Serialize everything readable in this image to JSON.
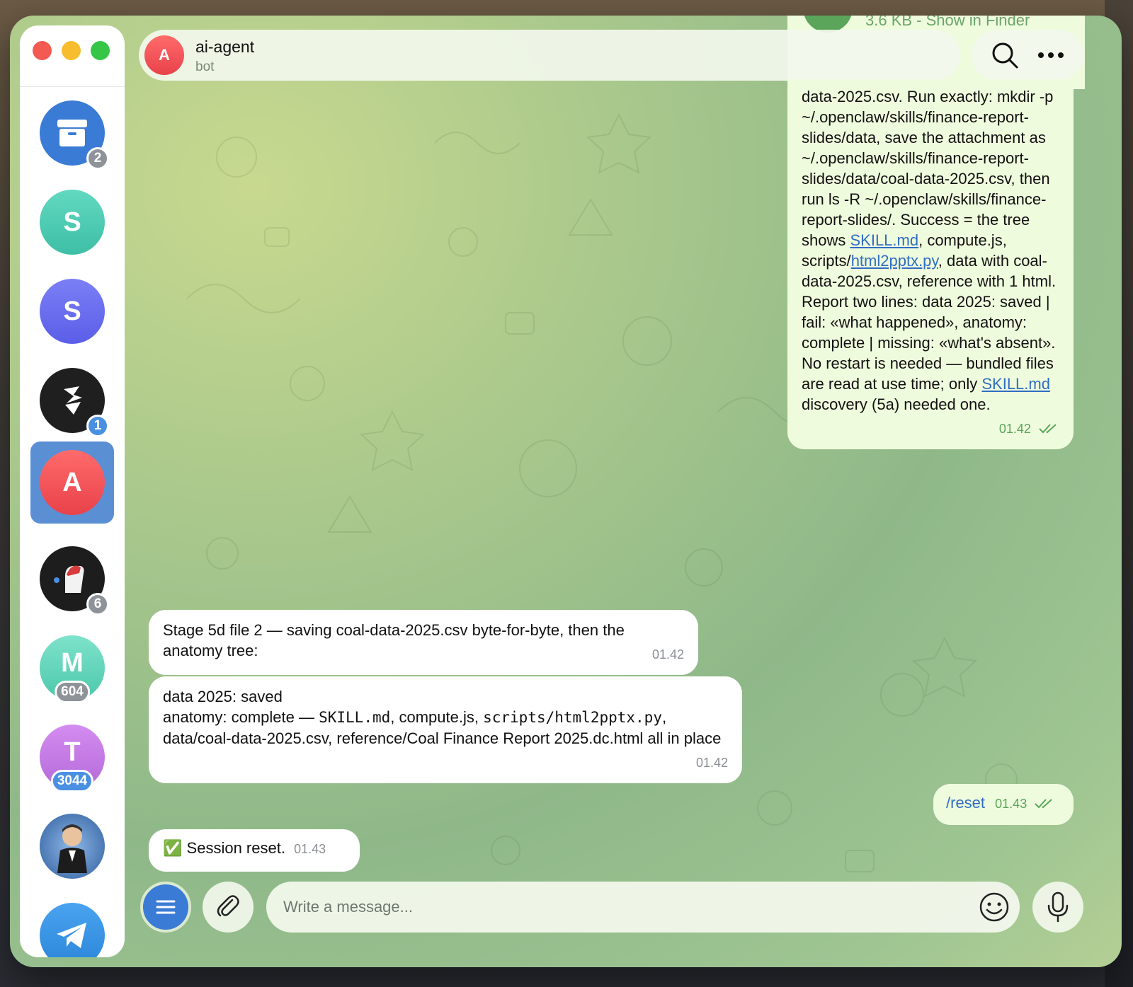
{
  "window": {
    "traffic_lights": [
      "close",
      "minimize",
      "zoom"
    ]
  },
  "sidebar": {
    "items": [
      {
        "kind": "archive",
        "icon": "archive-icon",
        "badge": "2",
        "color": "#3a7bd5"
      },
      {
        "kind": "letter",
        "letter": "S",
        "badge": "",
        "color": "#45c9b0"
      },
      {
        "kind": "letter",
        "letter": "S",
        "badge": "",
        "color": "#6366f1"
      },
      {
        "kind": "logo",
        "icon": "stack-logo-icon",
        "badge": "1",
        "color": "#1f1f1f"
      },
      {
        "kind": "letter",
        "letter": "A",
        "badge": "",
        "color": "#ef5350",
        "active": true
      },
      {
        "kind": "image",
        "icon": "fist-photo-icon",
        "badge": "6",
        "color": "#222"
      },
      {
        "kind": "letter",
        "letter": "M",
        "badge": "604",
        "color": "#5fd1b8"
      },
      {
        "kind": "letter",
        "letter": "T",
        "badge": "3044",
        "color": "#c57de6"
      },
      {
        "kind": "image",
        "icon": "cartoon-man-icon",
        "badge": "",
        "color": "#3c6fb5"
      },
      {
        "kind": "telegram",
        "icon": "telegram-icon",
        "badge": "",
        "color": "#3a8ee6"
      }
    ]
  },
  "header": {
    "avatar_letter": "A",
    "title": "ai-agent",
    "subtitle": "bot"
  },
  "file_peek": {
    "size_text": "3.6 KB - Show in Finder"
  },
  "messages": {
    "m1": {
      "time": "01.42",
      "p1": "data-2025.csv. Run exactly: mkdir -p ~/.openclaw/skills/finance-report-slides/data, save the attachment as ~/.openclaw/skills/finance-report-slides/data/coal-data-2025.csv, then run ls -R ~/.openclaw/skills/finance-report-slides/. Success = the tree shows ",
      "link1": "SKILL.md",
      "p2": ", compute.js, scripts/",
      "link2": "html2pptx.py",
      "p3": ", data with coal-data-2025.csv, reference with 1 html. Report two lines: data 2025: saved | fail: «what happened», anatomy: complete | missing: «what's absent». No restart is needed — bundled files are read at use time; only ",
      "link3": "SKILL.md",
      "p4": " discovery (5a) needed one."
    },
    "m2": {
      "text": "Stage 5d file 2 — saving coal-data-2025.csv byte-for-byte, then the anatomy tree:",
      "time": "01.42"
    },
    "m3": {
      "line1": "data 2025: saved",
      "line2_pre": "anatomy: complete — ",
      "code1": "SKILL.md",
      "line2_mid": ", compute.js, ",
      "code2": "scripts/html2pptx.py",
      "line2_post": ", data/coal-data-2025.csv, reference/Coal Finance Report 2025.dc.html all in place",
      "time": "01.42"
    },
    "m4": {
      "text": "/reset",
      "time": "01.43"
    },
    "m5": {
      "emoji": "✅",
      "text": "Session reset.",
      "time": "01.43"
    }
  },
  "composer": {
    "placeholder": "Write a message..."
  }
}
